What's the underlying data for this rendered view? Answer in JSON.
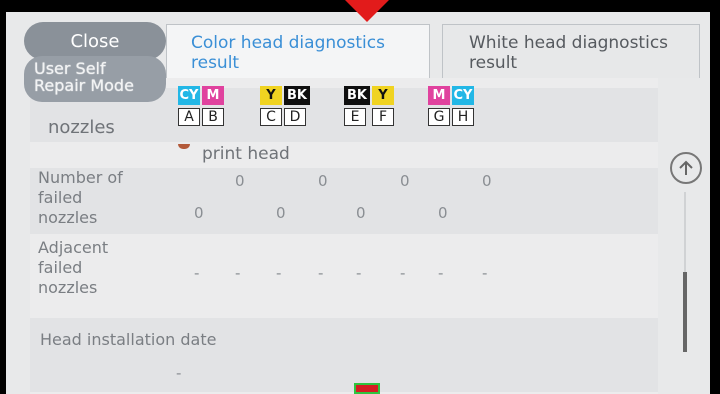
{
  "header": {
    "close_label": "Close",
    "tabs": [
      {
        "label_line1": "Color head diagnostics",
        "label_line2": "result"
      },
      {
        "label_line1": "White head diagnostics",
        "label_line2": "result"
      }
    ],
    "breadcrumb": {
      "line1": "User Self",
      "line2": "Repair Mode"
    }
  },
  "nozzles_header": {
    "label": "nozzles",
    "groups": [
      {
        "swatches": [
          {
            "text": "CY",
            "bg": "#22b7e6",
            "fg": "#ffffff"
          },
          {
            "text": "M",
            "bg": "#e0429e",
            "fg": "#ffffff"
          }
        ],
        "letters": [
          "A",
          "B"
        ]
      },
      {
        "swatches": [
          {
            "text": "Y",
            "bg": "#f0d321",
            "fg": "#111111"
          },
          {
            "text": "BK",
            "bg": "#0f0f0f",
            "fg": "#ffffff"
          }
        ],
        "letters": [
          "C",
          "D"
        ]
      },
      {
        "swatches": [
          {
            "text": "BK",
            "bg": "#0f0f0f",
            "fg": "#ffffff"
          },
          {
            "text": "Y",
            "bg": "#f0d321",
            "fg": "#111111"
          }
        ],
        "letters": [
          "E",
          "F"
        ]
      },
      {
        "swatches": [
          {
            "text": "M",
            "bg": "#e0429e",
            "fg": "#ffffff"
          },
          {
            "text": "CY",
            "bg": "#22b7e6",
            "fg": "#ffffff"
          }
        ],
        "letters": [
          "G",
          "H"
        ]
      }
    ]
  },
  "print_head_label": "print head",
  "rows": {
    "failed": {
      "label_line1": "Number of",
      "label_line2": "failed",
      "label_line3": "nozzles",
      "top_values": [
        "0",
        "0",
        "0",
        "0"
      ],
      "bottom_values": [
        "0",
        "0",
        "0",
        "0"
      ]
    },
    "adjacent": {
      "label_line1": "Adjacent",
      "label_line2": "failed",
      "label_line3": "nozzles",
      "values": [
        "-",
        "-",
        "-",
        "-",
        "-",
        "-",
        "-",
        "-"
      ]
    },
    "install": {
      "label": "Head installation date",
      "value": "-"
    }
  }
}
